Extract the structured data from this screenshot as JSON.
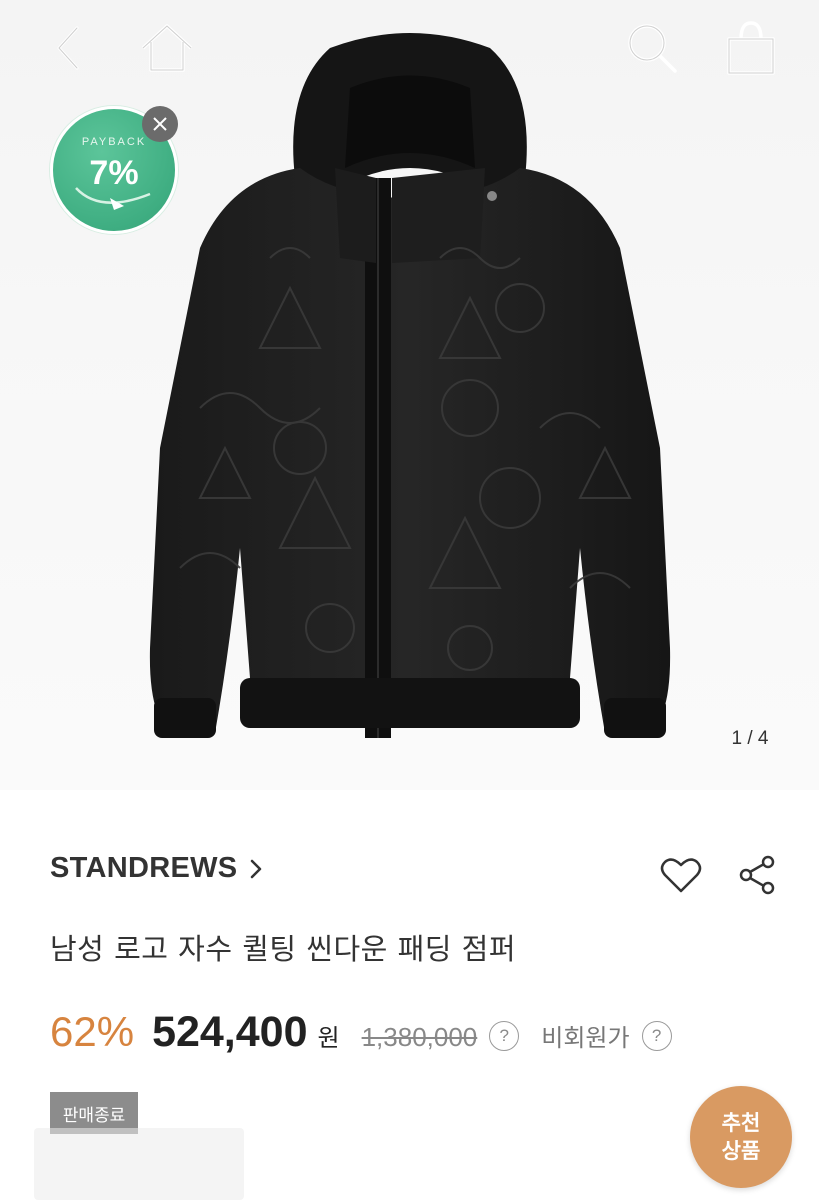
{
  "header": {
    "back_icon": "chevron-left-icon",
    "home_icon": "home-icon",
    "search_icon": "search-icon",
    "cart_icon": "shopping-bag-icon"
  },
  "payback_badge": {
    "label": "PAYBACK",
    "value": "7%",
    "color": "#3fae82",
    "close_icon": "close-icon"
  },
  "gallery": {
    "image_alt": "black quilted hooded jacket",
    "counter": "1 / 4"
  },
  "product": {
    "brand": "STANDREWS",
    "title": "남성 로고 자수 퀼팅 씬다운 패딩 점퍼",
    "discount": "62%",
    "sale_price": "524,400",
    "currency": "원",
    "original_price": "1,380,000",
    "price_help": "?",
    "nonmember_label": "비회원가",
    "nonmember_help": "?",
    "status": "판매종료"
  },
  "actions": {
    "wish_icon": "heart-icon",
    "share_icon": "share-icon"
  },
  "recommend_button": {
    "line1": "추천",
    "line2": "상품",
    "color": "#d99a62"
  },
  "colors": {
    "discount": "#d7843f",
    "soldout_bg": "#8c8c8c"
  }
}
